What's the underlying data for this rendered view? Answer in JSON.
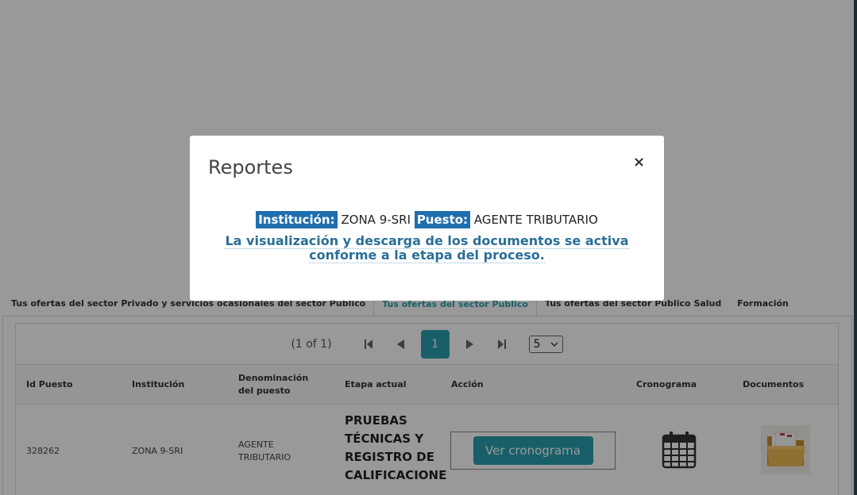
{
  "tabs": [
    {
      "label": "Tus ofertas del sector Privado y servicios ocasionales del sector Publico",
      "active": false
    },
    {
      "label": "Tus ofertas del sector Publico",
      "active": true
    },
    {
      "label": "Tus ofertas del sector Publico Salud",
      "active": false
    },
    {
      "label": "Formación",
      "active": false
    }
  ],
  "paginator": {
    "report": "(1 of 1)",
    "first_icon": "first-page-icon",
    "prev_icon": "prev-page-icon",
    "current_page": "1",
    "next_icon": "next-page-icon",
    "last_icon": "last-page-icon",
    "rows_per_page": "5"
  },
  "table": {
    "headers": [
      "Id Puesto",
      "Institución",
      "Denominación del puesto",
      "Etapa actual",
      "Acción",
      "Cronograma",
      "Documentos"
    ],
    "rows": [
      {
        "id": "328262",
        "institucion": "ZONA 9-SRI",
        "denominacion": "AGENTE TRIBUTARIO",
        "etapa": "PRUEBAS TÉCNICAS Y REGISTRO DE CALIFICACIONE",
        "accion_label": "Ver cronograma",
        "cronograma_icon": "calendar-icon",
        "documentos_icon": "folder-icon"
      }
    ]
  },
  "modal": {
    "title": "Reportes",
    "close_label": "×",
    "institucion_label": "Institución:",
    "institucion_value": "ZONA 9-SRI",
    "puesto_label": "Puesto:",
    "puesto_value": "AGENTE TRIBUTARIO",
    "note": "La visualización y descarga de los documentos se activa conforme a la etapa del proceso."
  },
  "colors": {
    "accent": "#2a9fb0",
    "label_highlight": "#1f6fae",
    "note_text": "#2a6f97",
    "overlay": "rgba(0,0,0,0.4)"
  }
}
